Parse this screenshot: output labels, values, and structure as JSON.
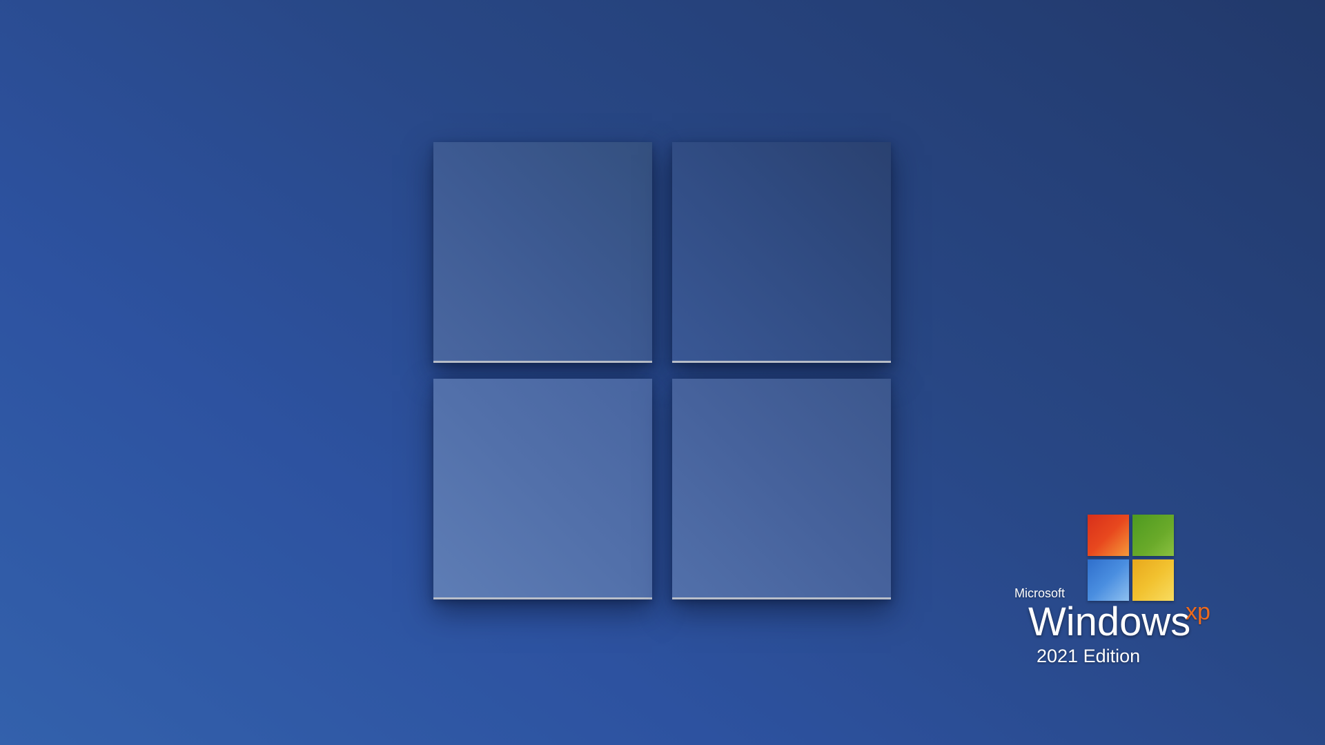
{
  "wallpaper": {
    "gradient_colors": [
      "#3361ac",
      "#2d52a0",
      "#284785",
      "#22396b"
    ],
    "big_logo": {
      "icon": "windows-11-logo-icon",
      "pane_colors": {
        "top_left": "#3d5a92",
        "top_right": "#2f4a80",
        "bottom_left": "#5270aa",
        "bottom_right": "#46629c"
      },
      "edge_highlight": "#b9bfca"
    }
  },
  "branding": {
    "maker": "Microsoft",
    "product": "Windows",
    "product_suffix": "xp",
    "edition": "2021 Edition",
    "flag_icon": "windows-xp-flag-icon",
    "flag_colors": {
      "red": "#e8481e",
      "green": "#6aaa2a",
      "blue": "#4a8ee0",
      "yellow": "#f2c230"
    },
    "suffix_color": "#ee6a1c"
  }
}
